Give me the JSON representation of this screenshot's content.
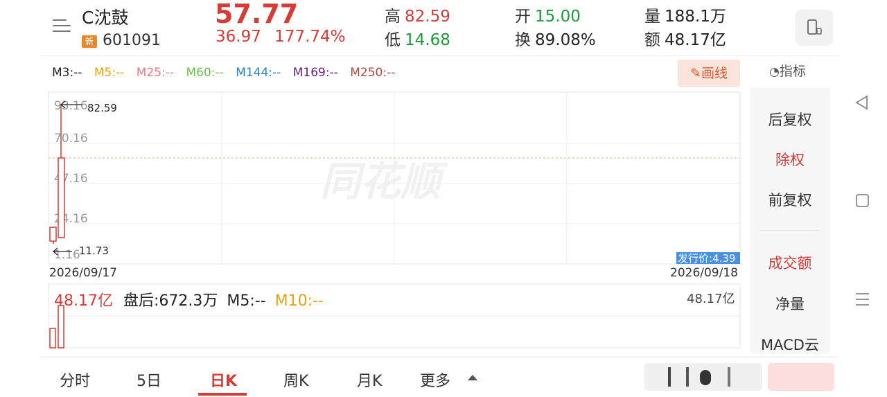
{
  "header": {
    "stock_name": "C沈鼓",
    "new_badge": "新",
    "stock_code": "601091",
    "price": "57.77",
    "change": "36.97",
    "change_pct": "177.74%",
    "high_label": "高",
    "high_value": "82.59",
    "low_label": "低",
    "low_value": "14.68",
    "open_label": "开",
    "open_value": "15.00",
    "turnover_label": "换",
    "turnover_value": "89.08%",
    "volume_label": "量",
    "volume_value": "188.1万",
    "amount_label": "额",
    "amount_value": "48.17亿"
  },
  "ma_legend": {
    "m3": "M3:--",
    "m5": "M5:--",
    "m25": "M25:--",
    "m60": "M60:--",
    "m144": "M144:--",
    "m169": "M169:--",
    "m250": "M250:--"
  },
  "toolbar": {
    "draw_label": "画线",
    "indicator_label": "指标"
  },
  "chart": {
    "y_ticks": [
      "93.16",
      "70.16",
      "47.16",
      "24.16",
      "1.16"
    ],
    "max_marker": "82.59",
    "min_marker": "11.73",
    "issue_price_label": "发行价:4.39",
    "date_start": "2026/09/17",
    "date_end": "2026/09/18"
  },
  "volume_panel": {
    "amount": "48.17亿",
    "after_hours": "盘后:672.3万",
    "m5": "M5:--",
    "m10": "M10:--",
    "right_value": "48.17亿"
  },
  "right_panel": {
    "items": [
      "后复权",
      "除权",
      "前复权",
      "成交额",
      "净量",
      "MACD云"
    ]
  },
  "tabs": [
    "分时",
    "5日",
    "日K",
    "周K",
    "月K",
    "更多"
  ],
  "colors": {
    "accent_red": "#d63b36",
    "green": "#1a9a3a",
    "ma3": "#222222",
    "ma5": "#e8a317",
    "ma25": "#e87a8a",
    "ma60": "#6cbf4a",
    "ma144": "#2f7fc1",
    "ma169": "#6a1a7a",
    "ma250": "#b5473a"
  }
}
